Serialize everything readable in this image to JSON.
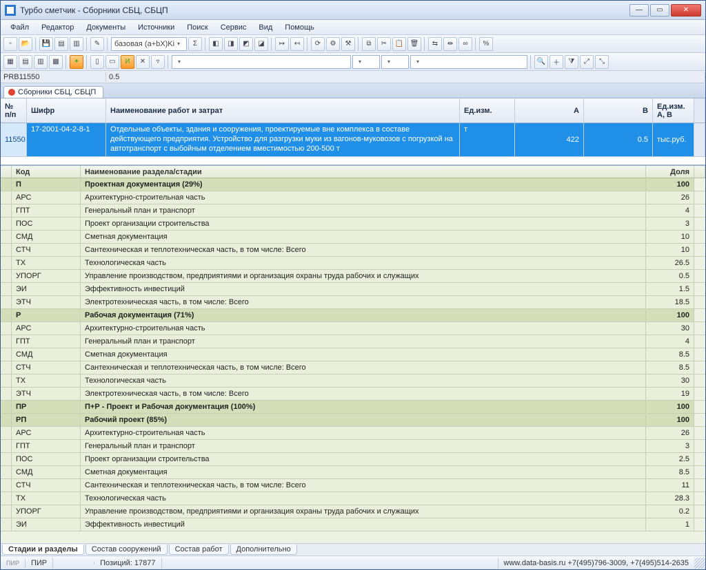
{
  "window": {
    "title": "Турбо сметчик - Сборники СБЦ, СБЦП"
  },
  "menu": [
    "Файл",
    "Редактор",
    "Документы",
    "Источники",
    "Поиск",
    "Сервис",
    "Вид",
    "Помощь"
  ],
  "combo_mode": "базовая (a+bX)Ki",
  "idrow": {
    "left": "PRB11550",
    "right": "0.5"
  },
  "toptab": "Сборники СБЦ, СБЦП",
  "upper": {
    "headers": {
      "n": "№ п/п",
      "code": "Шифр",
      "name": "Наименование работ и затрат",
      "unit": "Ед.изм.",
      "a": "A",
      "b": "B",
      "uab": "Ед.изм. A, B"
    },
    "row": {
      "n": "11550",
      "code": "17-2001-04-2-8-1",
      "name": "Отдельные объекты, здания и сооружения, проектируемые вне комплекса в составе действующего предприятия. Устройство для разгрузки муки из вагонов-муковозов с погрузкой на автотранспорт с выбойным отделением вместимостью 200-500 т",
      "unit": "т",
      "a": "422",
      "b": "0.5",
      "uab": "тыс.руб."
    }
  },
  "lower": {
    "headers": {
      "code": "Код",
      "name": "Наименование раздела/стадии",
      "val": "Доля"
    },
    "rows": [
      {
        "sect": true,
        "code": "П",
        "name": "Проектная документация (29%)",
        "val": "100"
      },
      {
        "code": "АРС",
        "name": "Архитектурно-строительная часть",
        "val": "26"
      },
      {
        "code": "ГПТ",
        "name": "Генеральный план и транспорт",
        "val": "4"
      },
      {
        "code": "ПОС",
        "name": "Проект организации строительства",
        "val": "3"
      },
      {
        "code": "СМД",
        "name": "Сметная документация",
        "val": "10"
      },
      {
        "code": "СТЧ",
        "name": "Сантехническая и теплотехническая часть, в том числе: Всего",
        "val": "10"
      },
      {
        "code": "ТХ",
        "name": "Технологическая часть",
        "val": "26.5"
      },
      {
        "code": "УПОРГ",
        "name": "Управление производством, предприятиями и организация охраны труда рабочих и служащих",
        "val": "0.5"
      },
      {
        "code": "ЭИ",
        "name": "Эффективность инвестиций",
        "val": "1.5"
      },
      {
        "code": "ЭТЧ",
        "name": "Электротехническая часть, в том числе: Всего",
        "val": "18.5"
      },
      {
        "sect": true,
        "code": "Р",
        "name": "Рабочая документация (71%)",
        "val": "100"
      },
      {
        "code": "АРС",
        "name": "Архитектурно-строительная часть",
        "val": "30"
      },
      {
        "code": "ГПТ",
        "name": "Генеральный план и транспорт",
        "val": "4"
      },
      {
        "code": "СМД",
        "name": "Сметная документация",
        "val": "8.5"
      },
      {
        "code": "СТЧ",
        "name": "Сантехническая и теплотехническая часть, в том числе: Всего",
        "val": "8.5"
      },
      {
        "code": "ТХ",
        "name": "Технологическая часть",
        "val": "30"
      },
      {
        "code": "ЭТЧ",
        "name": "Электротехническая часть, в том числе: Всего",
        "val": "19"
      },
      {
        "sect": true,
        "code": "ПР",
        "name": "П+Р - Проект и Рабочая документация (100%)",
        "val": "100"
      },
      {
        "sect": true,
        "code": "РП",
        "name": "Рабочий проект (85%)",
        "val": "100"
      },
      {
        "code": "АРС",
        "name": "Архитектурно-строительная часть",
        "val": "26"
      },
      {
        "code": "ГПТ",
        "name": "Генеральный план и транспорт",
        "val": "3"
      },
      {
        "code": "ПОС",
        "name": "Проект организации строительства",
        "val": "2.5"
      },
      {
        "code": "СМД",
        "name": "Сметная документация",
        "val": "8.5"
      },
      {
        "code": "СТЧ",
        "name": "Сантехническая и теплотехническая часть, в том числе: Всего",
        "val": "11"
      },
      {
        "code": "ТХ",
        "name": "Технологическая часть",
        "val": "28.3"
      },
      {
        "code": "УПОРГ",
        "name": "Управление производством, предприятиями и организация охраны труда рабочих и служащих",
        "val": "0.2"
      },
      {
        "code": "ЭИ",
        "name": "Эффективность инвестиций",
        "val": "1"
      }
    ]
  },
  "btabs": [
    "Стадии и разделы",
    "Состав сооружений",
    "Состав работ",
    "Дополнительно"
  ],
  "status": {
    "mode1": "ПИР",
    "mode0": "ПИР",
    "pos_label": "Позиций:",
    "pos_val": "17877",
    "right": "www.data-basis.ru  +7(495)796-3009, +7(495)514-2635"
  }
}
